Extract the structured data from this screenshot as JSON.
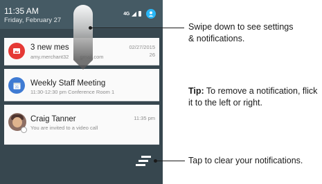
{
  "status_bar": {
    "time": "11:35 AM",
    "date": "Friday, February 27",
    "network_label": "4G"
  },
  "notifications": [
    {
      "title": "3 new mes",
      "subtitle": "amy.merchant32",
      "subtitle_suffix": "gmail.com",
      "time": "02/27/2015",
      "count": "26",
      "icon": "photo-app-icon"
    },
    {
      "title": "Weekly Staff Meeting",
      "subtitle": "11:30-12:30 pm Conference Room 1",
      "icon": "calendar-icon",
      "calendar_day": "31"
    },
    {
      "title": "Craig Tanner",
      "subtitle": "You are invited to a video call",
      "time": "11:35 pm",
      "icon": "avatar"
    }
  ],
  "callouts": {
    "swipe": "Swipe down to see settings & notifications.",
    "tip_label": "Tip:",
    "tip": " To remove a notification, flick it to the left or right.",
    "clear": "Tap to clear your notifications."
  },
  "colors": {
    "phone_bg": "#37474f",
    "status_bar": "#455a64",
    "profile_badge": "#29b6f6",
    "photo_app": "#e53935",
    "calendar_app": "#3f7bd3"
  }
}
